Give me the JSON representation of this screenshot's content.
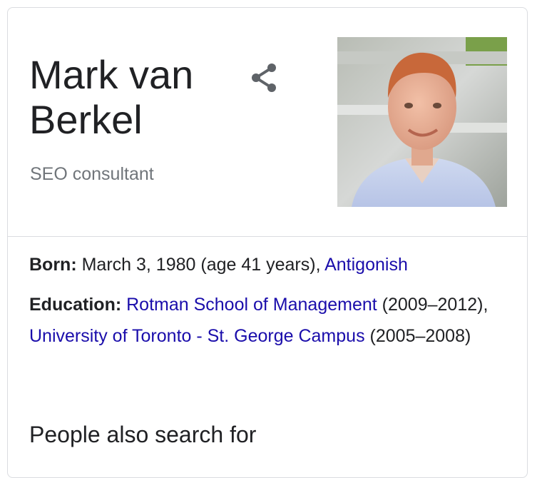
{
  "header": {
    "name": "Mark van Berkel",
    "description": "SEO consultant",
    "share_icon": "share-icon"
  },
  "photo": {
    "subject": "portrait-photo"
  },
  "facts": {
    "born": {
      "label": "Born:",
      "text": "March 3, 1980 (age 41 years),",
      "place_link": "Antigonish"
    },
    "education": {
      "label": "Education:",
      "school1_link": "Rotman School of Management",
      "school1_years": "(2009–2012),",
      "school2_link": "University of Toronto - St. George Campus",
      "school2_years": "(2005–2008)"
    }
  },
  "sections": {
    "people_also_search_for": "People also search for"
  },
  "colors": {
    "link": "#1a0dab",
    "text": "#202124",
    "muted": "#70757a",
    "border": "#dadce0"
  }
}
